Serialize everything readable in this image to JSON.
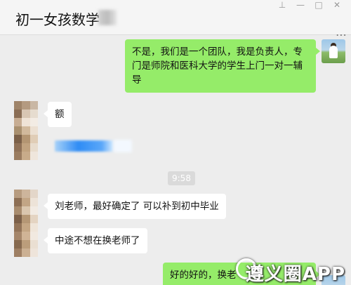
{
  "header": {
    "title": "初一女孩数学",
    "minimize_icon": "minimize-icon",
    "maximize_icon": "maximize-icon",
    "close_icon": "close-icon",
    "more_icon": "more-icon"
  },
  "messages": [
    {
      "sender": "self",
      "text": "不是，我们是一个团队，我是负责人，专门是师院和医科大学的学生上门一对一辅导"
    },
    {
      "sender": "other",
      "text": "额"
    },
    {
      "sender": "other",
      "text": ""
    },
    {
      "sender": "other",
      "text": "刘老师，最好确定了 可以补到初中毕业"
    },
    {
      "sender": "other",
      "text": "中途不想在换老师了"
    },
    {
      "sender": "self",
      "text": "好的好的，换老"
    }
  ],
  "timestamp": "9:58",
  "watermark": "遵义圈APP",
  "colors": {
    "self_bubble": "#95ec69",
    "other_bubble": "#ffffff",
    "background": "#ededed"
  }
}
